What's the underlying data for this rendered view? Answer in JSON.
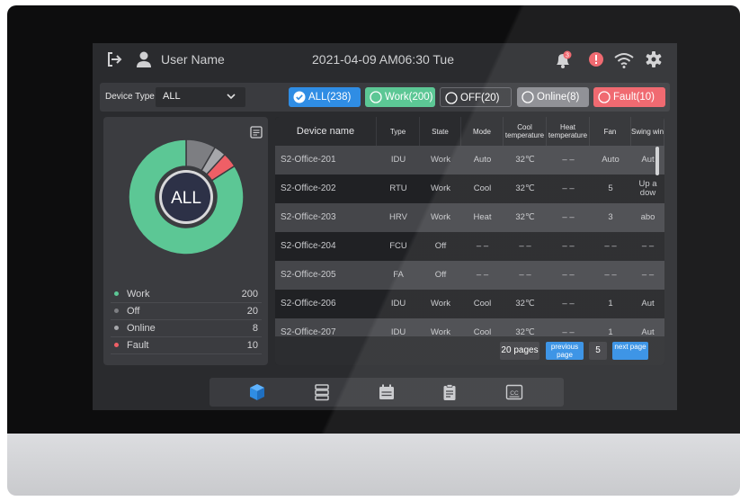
{
  "status_bar": {
    "user_name": "User Name",
    "datetime": "2021-04-09 AM06:30 Tue",
    "notification_count": "3",
    "icons": [
      "logout-icon",
      "user-icon",
      "bell-icon",
      "alert-icon",
      "wifi-icon",
      "gear-icon"
    ]
  },
  "filters": {
    "device_type_label": "Device Type",
    "device_type_value": "ALL",
    "chips": [
      {
        "label": "ALL(238)",
        "color": "#2f8de4",
        "selected": true
      },
      {
        "label": "Work(200)",
        "color": "#5cc795"
      },
      {
        "label": "OFF(20)",
        "color": "#3d3e42"
      },
      {
        "label": "Online(8)",
        "color": "#898a8f"
      },
      {
        "label": "Fault(10)",
        "color": "#ef5f66"
      }
    ]
  },
  "summary": {
    "center_label": "ALL",
    "legend": [
      {
        "label": "Work",
        "value": "200",
        "color": "#5cc795"
      },
      {
        "label": "Off",
        "value": "20",
        "color": "#7d7e82"
      },
      {
        "label": "Online",
        "value": "8",
        "color": "#a6a7ab"
      },
      {
        "label": "Fault",
        "value": "10",
        "color": "#ef5f66"
      }
    ]
  },
  "table": {
    "headers": [
      "Device name",
      "Type",
      "State",
      "Mode",
      "Cool temperature",
      "Heat temperature",
      "Fan",
      "Swing win"
    ],
    "rows": [
      [
        "S2-Office-201",
        "IDU",
        "Work",
        "Auto",
        "32℃",
        "– –",
        "Auto",
        "Aut"
      ],
      [
        "S2-Office-202",
        "RTU",
        "Work",
        "Cool",
        "32℃",
        "– –",
        "5",
        "Up a dow"
      ],
      [
        "S2-Office-203",
        "HRV",
        "Work",
        "Heat",
        "32℃",
        "– –",
        "3",
        "abo"
      ],
      [
        "S2-Office-204",
        "FCU",
        "Off",
        "– –",
        "– –",
        "– –",
        "– –",
        "– –"
      ],
      [
        "S2-Office-205",
        "FA",
        "Off",
        "– –",
        "– –",
        "– –",
        "– –",
        "– –"
      ],
      [
        "S2-Office-206",
        "IDU",
        "Work",
        "Cool",
        "32℃",
        "– –",
        "1",
        "Aut"
      ],
      [
        "S2-Office-207",
        "IDU",
        "Work",
        "Cool",
        "32℃",
        "– –",
        "1",
        "Aut"
      ]
    ]
  },
  "pagination": {
    "total_pages": "20 pages",
    "previous_label": "previous page",
    "current_page": "5",
    "next_label": "next page"
  },
  "bottom_nav": {
    "icons": [
      "cube-icon",
      "server-icon",
      "calendar-icon",
      "clipboard-icon",
      "cc-icon"
    ],
    "cc_text": "CC",
    "active_color": "#2f8de4"
  }
}
